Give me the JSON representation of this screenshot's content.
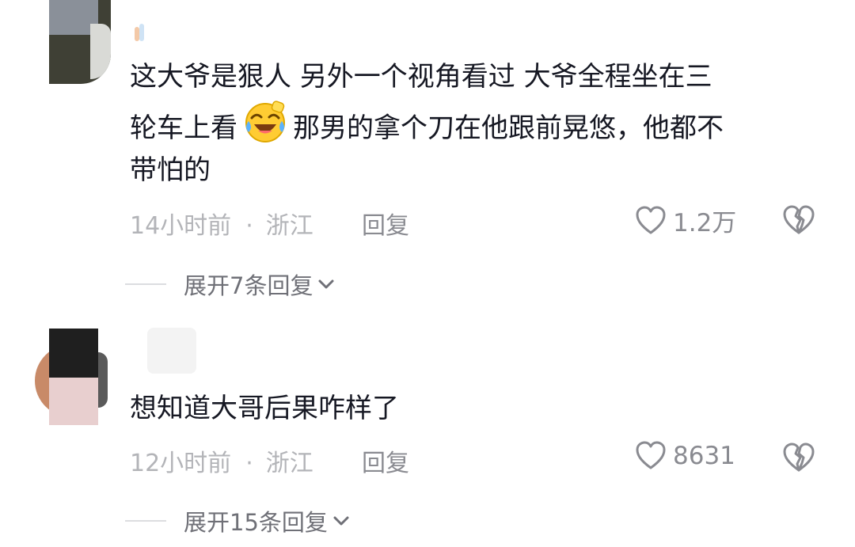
{
  "comments": [
    {
      "lines": [
        "这大爷是狠人 另外一个视角看过 大爷全程坐在三",
        "轮车上看",
        "那男的拿个刀在他跟前晃悠，他都不",
        "带怕的"
      ],
      "emoji": "laughing-tears-emoji",
      "time": "14小时前",
      "separator": "·",
      "location": "浙江",
      "reply": "回复",
      "likes": "1.2万",
      "expand": "展开7条回复"
    },
    {
      "lines": [
        "想知道大哥后果咋样了"
      ],
      "time": "12小时前",
      "separator": "·",
      "location": "浙江",
      "reply": "回复",
      "likes": "8631",
      "expand": "展开15条回复"
    }
  ],
  "icons": {
    "like": "heart-outline-icon",
    "dislike": "broken-heart-icon",
    "expand": "chevron-down-icon"
  },
  "colors": {
    "text": "#161823",
    "meta": "#b3b4b8",
    "secondary": "#8a8b91"
  }
}
